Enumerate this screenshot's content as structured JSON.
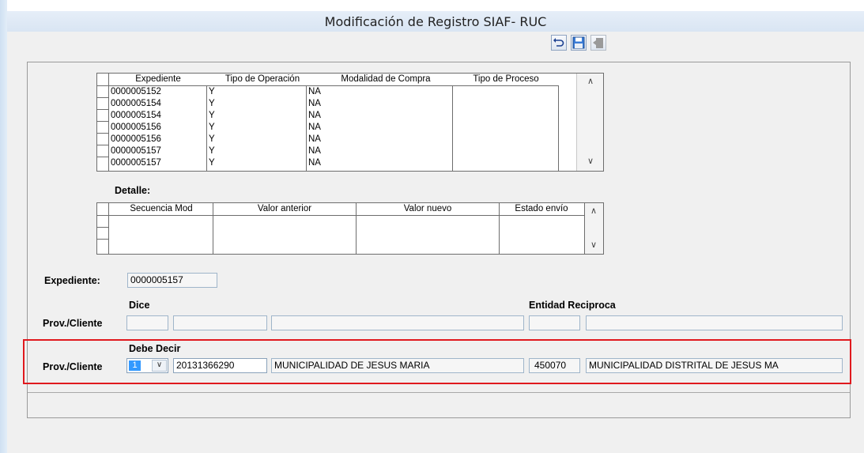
{
  "window": {
    "title": "Modificación de Registro SIAF- RUC"
  },
  "toolbar": {
    "buttons": [
      {
        "name": "undo-button",
        "icon": "undo-icon"
      },
      {
        "name": "save-button",
        "icon": "floppy-disk-icon"
      },
      {
        "name": "exit-button",
        "icon": "exit-door-icon"
      }
    ]
  },
  "main_grid": {
    "columns": [
      "Expediente",
      "Tipo de Operación",
      "Modalidad de Compra",
      "Tipo de Proceso"
    ],
    "rows": [
      [
        "0000005152",
        "Y",
        "NA",
        ""
      ],
      [
        "0000005154",
        "Y",
        "NA",
        ""
      ],
      [
        "0000005154",
        "Y",
        "NA",
        ""
      ],
      [
        "0000005156",
        "Y",
        "NA",
        ""
      ],
      [
        "0000005156",
        "Y",
        "NA",
        ""
      ],
      [
        "0000005157",
        "Y",
        "NA",
        ""
      ],
      [
        "0000005157",
        "Y",
        "NA",
        ""
      ]
    ]
  },
  "detail": {
    "label": "Detalle:",
    "columns": [
      "Secuencia Mod",
      "Valor anterior",
      "Valor nuevo",
      "Estado envío"
    ]
  },
  "expediente": {
    "label": "Expediente:",
    "value": "0000005157"
  },
  "dice": {
    "label": "Dice",
    "entidad_label": "Entidad Reciproca",
    "row_label": "Prov./Cliente"
  },
  "debe_decir": {
    "label": "Debe Decir",
    "row_label": "Prov./Cliente",
    "select_value": "1",
    "ruc": "20131366290",
    "name": "MUNICIPALIDAD DE JESUS MARIA",
    "entidad_code": "450070",
    "entidad_name": "MUNICIPALIDAD DISTRITAL DE JESUS MA"
  },
  "colors": {
    "highlight_border": "#e0191e",
    "select_highlight": "#3399ff"
  }
}
